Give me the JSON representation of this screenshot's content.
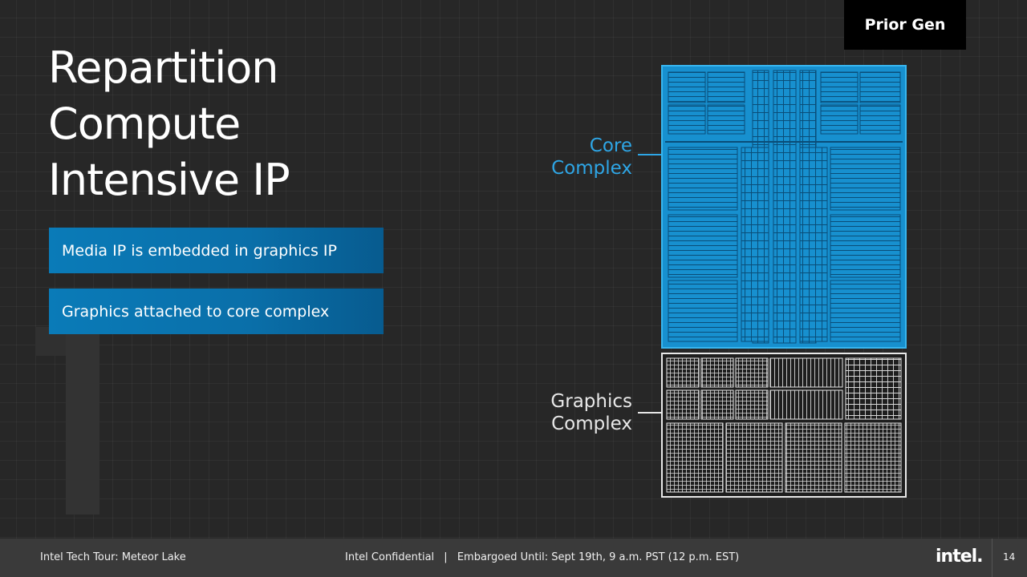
{
  "slide": {
    "title_lines": [
      "Repartition",
      "Compute",
      "Intensive IP"
    ],
    "bullets": [
      "Media IP is embedded in graphics IP",
      "Graphics attached to core complex"
    ],
    "tag": "Prior Gen",
    "labels": {
      "core": [
        "Core",
        "Complex"
      ],
      "graphics": [
        "Graphics",
        "Complex"
      ]
    },
    "colors": {
      "core": "#2ea6e6",
      "graphics": "#e8e8e8",
      "bullet": "#0a72ae"
    }
  },
  "footer": {
    "left": "Intel Tech Tour: Meteor Lake",
    "confidential": "Intel Confidential",
    "separator": "|",
    "embargo": "Embargoed Until: Sept 19th, 9 a.m. PST (12 p.m. EST)",
    "logo": "intel.",
    "page_number": "14"
  }
}
